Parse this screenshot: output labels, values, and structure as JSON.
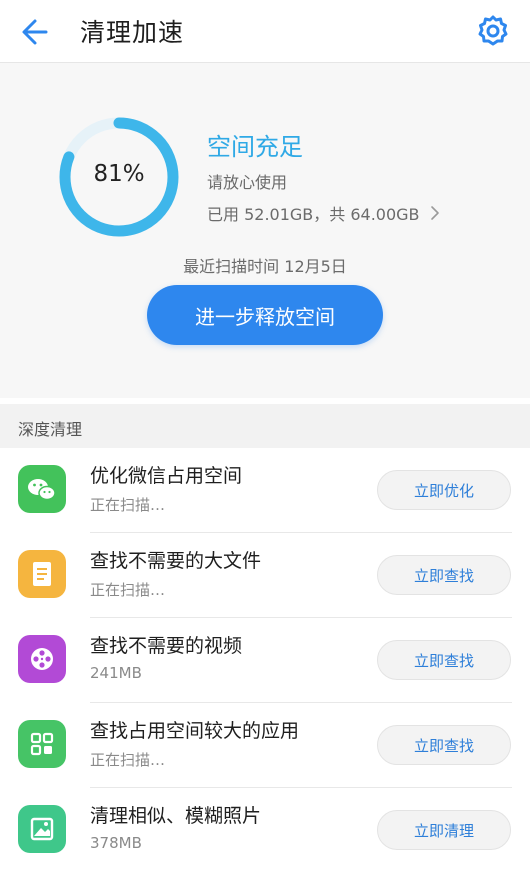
{
  "header": {
    "title": "清理加速",
    "back_icon": "arrow-left-icon",
    "settings_icon": "gear-icon"
  },
  "storage": {
    "percent_text": "81%",
    "percent_value": 81,
    "status_title": "空间充足",
    "status_sub": "请放心使用",
    "usage_text": "已用 52.01GB，共 64.00GB",
    "scan_time": "最近扫描时间 12月5日",
    "free_button": "进一步释放空间"
  },
  "section": {
    "title": "深度清理"
  },
  "items": [
    {
      "title": "优化微信占用空间",
      "sub": "正在扫描…",
      "button": "立即优化",
      "icon": "wechat-icon",
      "color": "#43c25b"
    },
    {
      "title": "查找不需要的大文件",
      "sub": "正在扫描…",
      "button": "立即查找",
      "icon": "document-icon",
      "color": "#f5b53f"
    },
    {
      "title": "查找不需要的视频",
      "sub": "241MB",
      "button": "立即查找",
      "icon": "film-reel-icon",
      "color": "#b24ad6"
    },
    {
      "title": "查找占用空间较大的应用",
      "sub": "正在扫描…",
      "button": "立即查找",
      "icon": "app-grid-icon",
      "color": "#46c466"
    },
    {
      "title": "清理相似、模糊照片",
      "sub": "378MB",
      "button": "立即清理",
      "icon": "photo-icon",
      "color": "#3fc78a"
    }
  ],
  "colors": {
    "accent": "#2e87ee",
    "ring": "#3eb6ea",
    "ring_track": "#e6f2f8",
    "status": "#2fa9e6"
  }
}
